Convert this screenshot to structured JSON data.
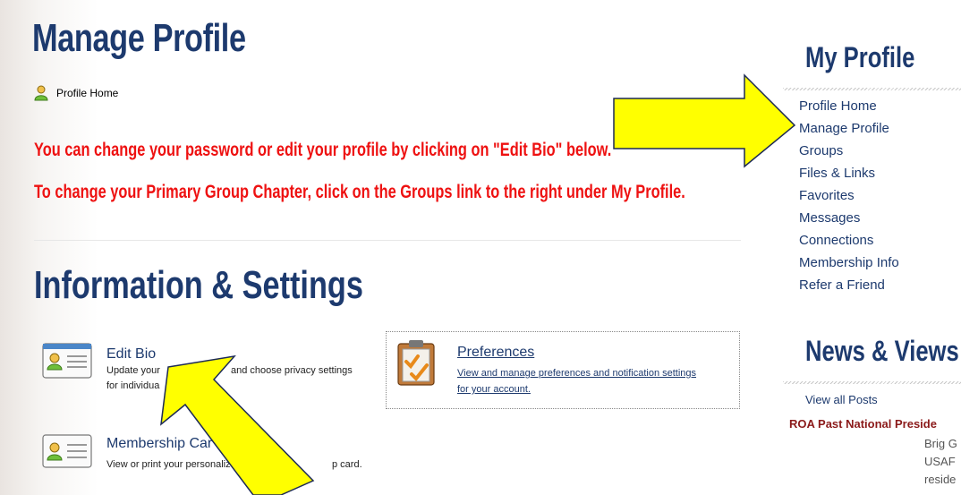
{
  "page": {
    "title": "Manage Profile",
    "breadcrumb": "Profile Home",
    "notice_1": "You can change your password or edit your profile by clicking on \"Edit Bio\" below.",
    "notice_2": "To change your Primary Group Chapter, click on the Groups link to the right under My Profile.",
    "section_title": "Information & Settings"
  },
  "cards": {
    "edit_bio": {
      "title": "Edit Bio",
      "desc_line1": "Update your",
      "desc_line1b": "and choose privacy settings",
      "desc_line2": "for individua"
    },
    "preferences": {
      "title": "Preferences",
      "desc": "View and manage preferences and notification settings for your account."
    },
    "membership_card": {
      "title": "Membership Car",
      "desc_a": "View or print your personaliz",
      "desc_b": "p card."
    }
  },
  "sidebar": {
    "title": "My Profile",
    "links": [
      "Profile Home",
      "Manage Profile",
      "Groups",
      "Files & Links",
      "Favorites",
      "Messages",
      "Connections",
      "Membership Info",
      "Refer a Friend"
    ]
  },
  "news": {
    "title": "News & Views",
    "view_all": "View all Posts",
    "headline": "ROA Past National Preside",
    "lines": [
      "Brig G",
      "USAF",
      "reside"
    ]
  },
  "colors": {
    "heading": "#1d3a6e",
    "notice": "#ee1111",
    "arrow_fill": "#ffff00",
    "news_headline": "#8b1a1a"
  },
  "icons": [
    "person-icon",
    "profile-card-icon",
    "clipboard-check-icon",
    "arrow-icon"
  ]
}
